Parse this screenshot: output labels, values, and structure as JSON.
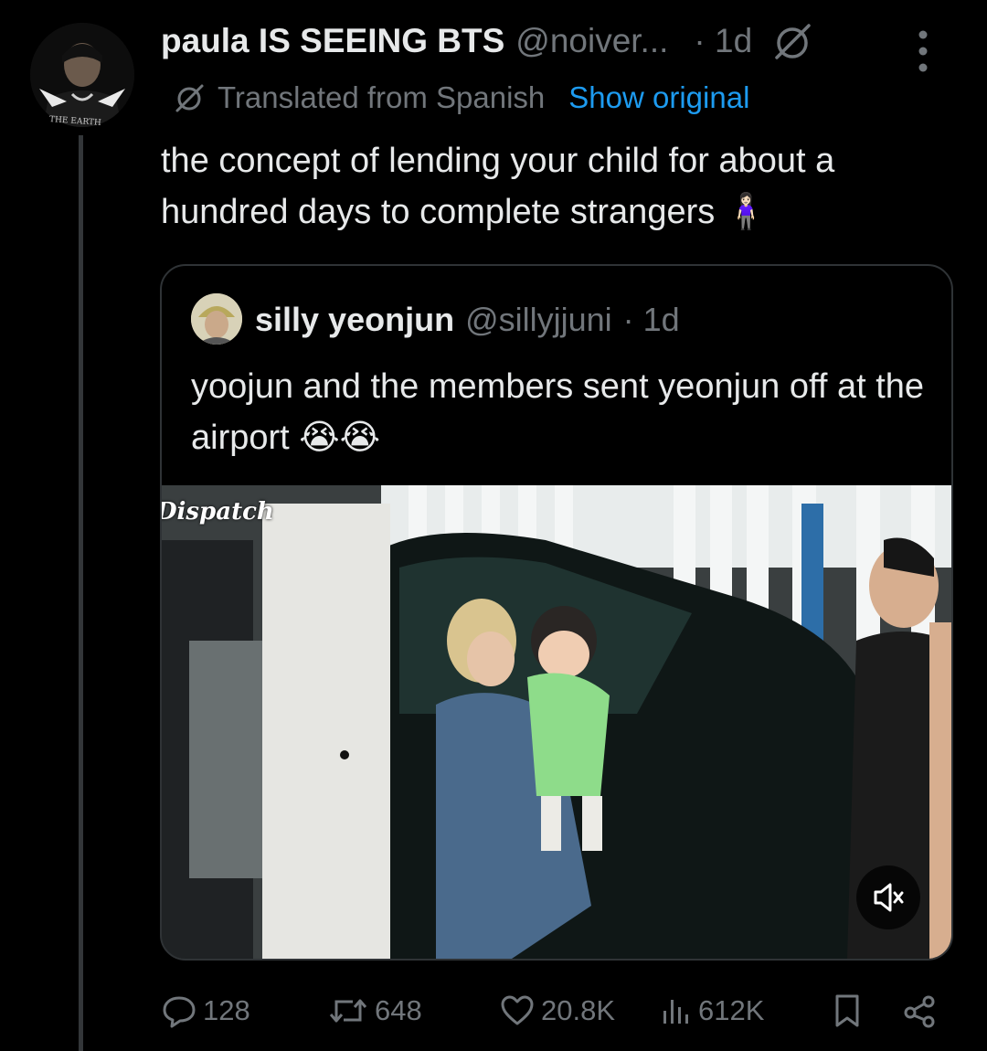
{
  "tweet": {
    "author_name": "paula IS SEEING BTS",
    "author_handle": "@noiver...",
    "time": "· 1d",
    "translation_note": "Translated from Spanish",
    "show_original": "Show original",
    "text": "the concept of lending your child for about a hundred days to complete strangers 🧍🏻‍♀️",
    "avatar_shirt_text": "THE EARTH"
  },
  "quote": {
    "author_name": "silly yeonjun",
    "author_handle": "@sillyjjuni",
    "time": "· 1d",
    "text": "yoojun and the members sent yeonjun off at the airport 😭😭",
    "media_watermark": "Dispatch"
  },
  "actions": {
    "replies": "128",
    "reposts": "648",
    "likes": "20.8K",
    "views": "612K"
  },
  "icons": {
    "grok": "grok-icon",
    "more": "more-icon",
    "translate": "translate-icon",
    "mute": "muted-speaker-icon",
    "reply": "reply-icon",
    "repost": "repost-icon",
    "like": "heart-icon",
    "views": "views-icon",
    "bookmark": "bookmark-icon",
    "share": "share-icon"
  },
  "colors": {
    "background": "#000000",
    "text": "#e7e9ea",
    "muted": "#71767b",
    "link": "#1d9bf0",
    "border": "#2f3336"
  }
}
